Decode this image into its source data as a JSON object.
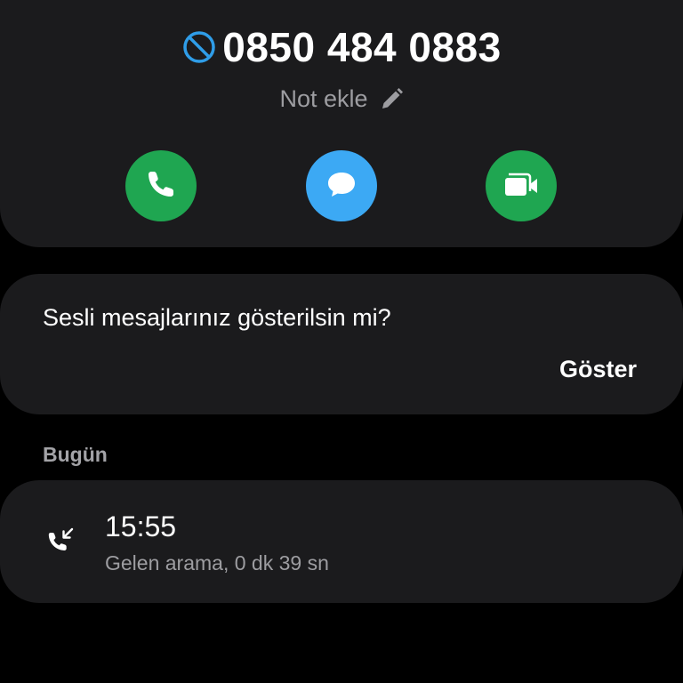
{
  "contact": {
    "number": "0850 484 0883",
    "blocked_icon": "block-icon",
    "note_label": "Not ekle",
    "note_icon": "pencil-icon"
  },
  "actions": [
    {
      "name": "call",
      "icon": "phone-icon",
      "color": "#1fa651"
    },
    {
      "name": "message",
      "icon": "chat-bubble-icon",
      "color": "#3ca9f4"
    },
    {
      "name": "video",
      "icon": "video-camera-icon",
      "color": "#1fa651"
    }
  ],
  "voicemail": {
    "question": "Sesli mesajlarınız gösterilsin mi?",
    "show_label": "Göster"
  },
  "history": {
    "section_label": "Bugün",
    "entries": [
      {
        "time": "15:55",
        "detail": "Gelen arama, 0 dk 39 sn",
        "icon": "incoming-call-icon"
      }
    ]
  },
  "colors": {
    "background": "#000000",
    "card": "#1b1b1d",
    "accent_blue": "#2f9de8",
    "secondary_text": "#9d9da1"
  }
}
